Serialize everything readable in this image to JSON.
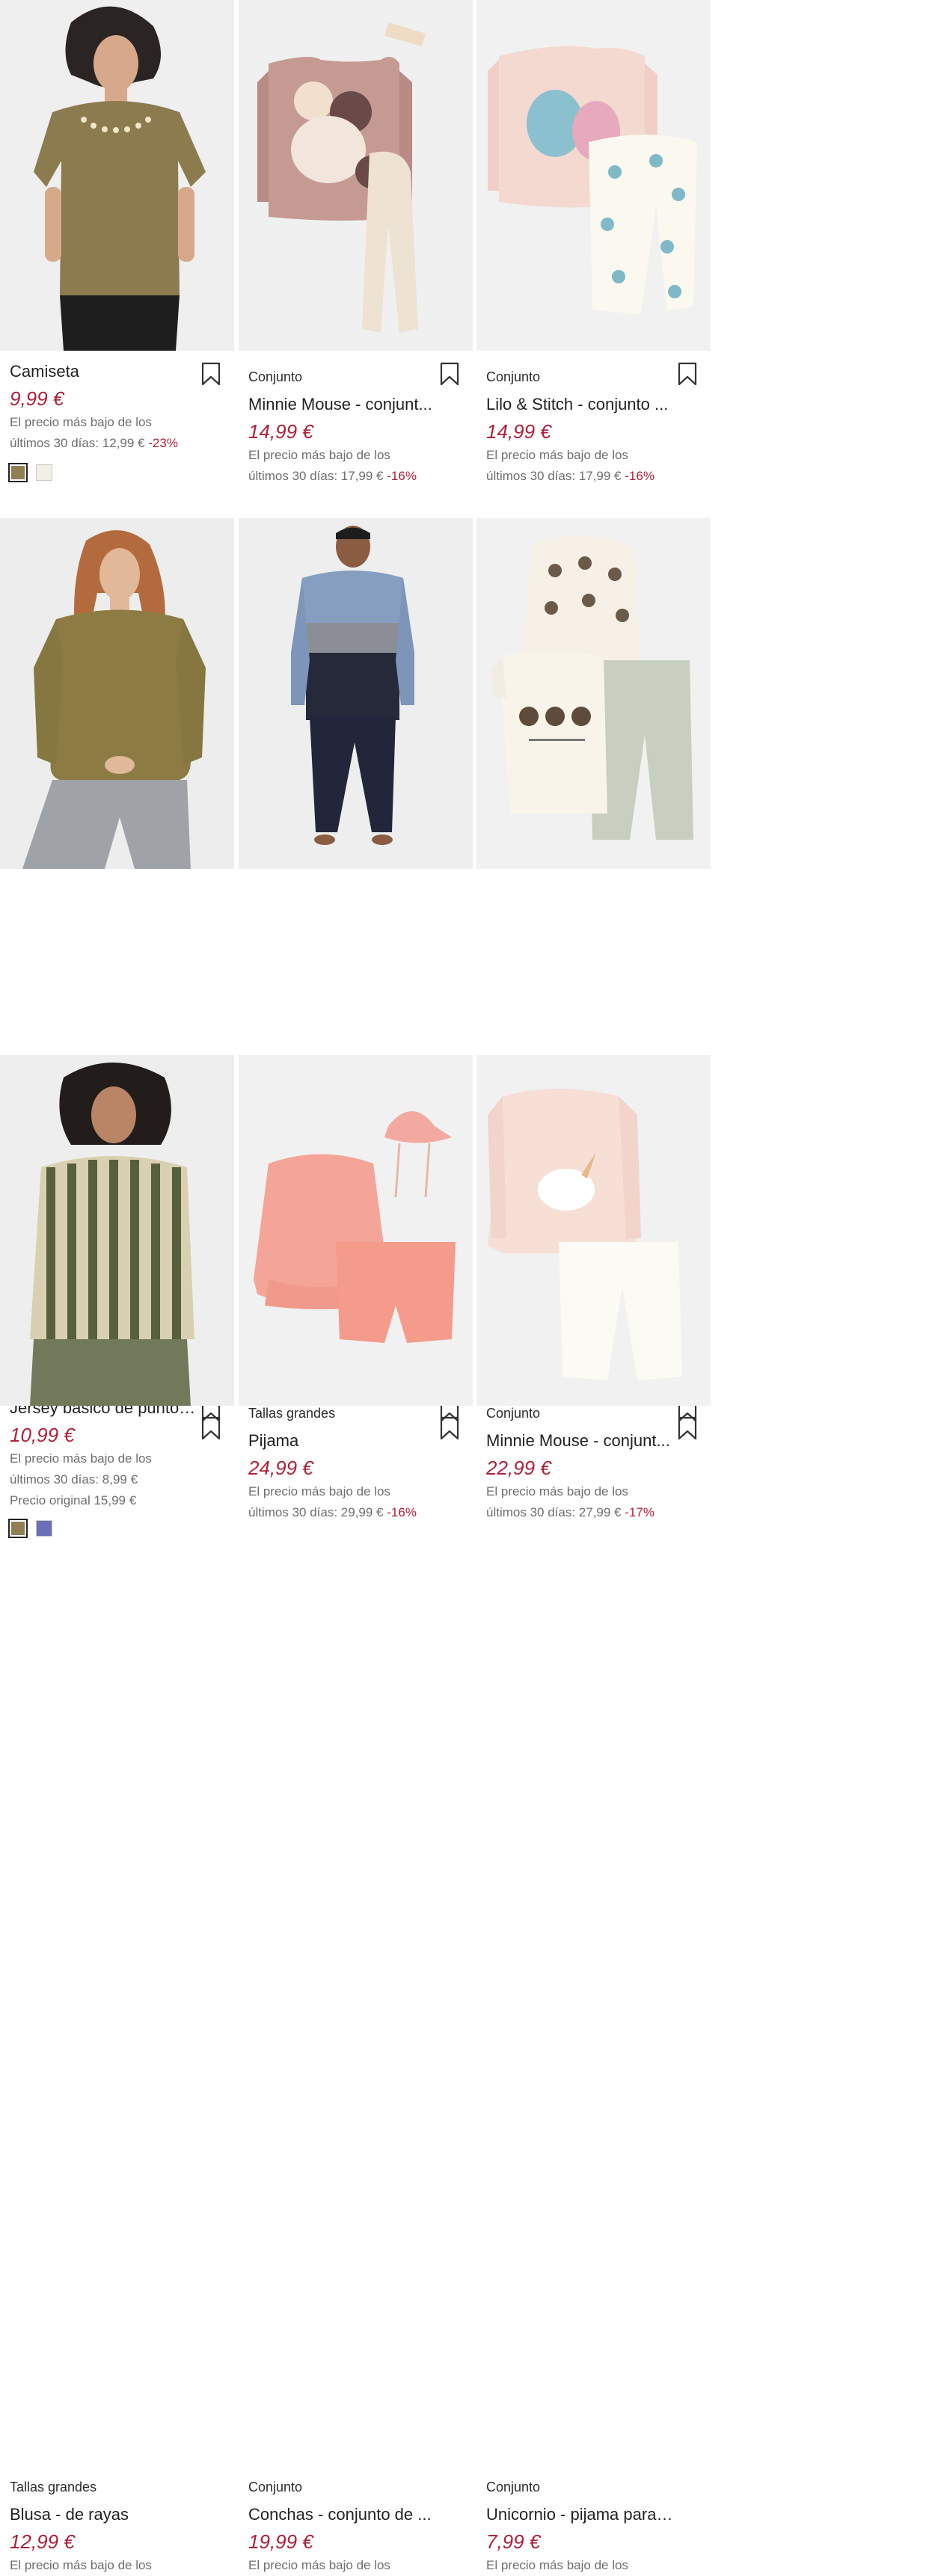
{
  "products": [
    {
      "category": "",
      "title": "Camiseta",
      "price": "9,99 €",
      "ref_line1": "El precio más bajo de los",
      "ref_line2": "últimos 30 días: 12,99 €",
      "discount": "-23%",
      "original": "",
      "swatches": [
        "#8f7f52",
        "#f1efe6"
      ],
      "image": "woman-olive-tshirt"
    },
    {
      "category": "Conjunto",
      "title": "Minnie Mouse - conjunt...",
      "price": "14,99 €",
      "ref_line1": "El precio más bajo de los",
      "ref_line2": "últimos 30 días: 17,99 €",
      "discount": "-16%",
      "original": "",
      "swatches": [],
      "image": "minnie-set-pink"
    },
    {
      "category": "Conjunto",
      "title": "Lilo & Stitch - conjunto ...",
      "price": "14,99 €",
      "ref_line1": "El precio más bajo de los",
      "ref_line2": "últimos 30 días: 17,99 €",
      "discount": "-16%",
      "original": "",
      "swatches": [],
      "image": "stitch-set"
    },
    {
      "category": "",
      "title": "Jersey básico de punto f...",
      "price": "10,99 €",
      "ref_line1": "El precio más bajo de los",
      "ref_line2": "últimos 30 días: 8,99 €",
      "discount": "",
      "original": "Precio original 15,99 €",
      "swatches": [
        "#8f7f52",
        "#6a6fb6"
      ],
      "image": "woman-olive-sweater"
    },
    {
      "category": "Tallas grandes",
      "title": "Pijama",
      "price": "24,99 €",
      "ref_line1": "El precio más bajo de los",
      "ref_line2": "últimos 30 días: 29,99 €",
      "discount": "-16%",
      "original": "",
      "swatches": [],
      "image": "man-pyjama"
    },
    {
      "category": "Conjunto",
      "title": "Minnie Mouse - conjunt...",
      "price": "22,99 €",
      "ref_line1": "El precio más bajo de los",
      "ref_line2": "últimos 30 días: 27,99 €",
      "discount": "-17%",
      "original": "",
      "swatches": [],
      "image": "minnie-set-3piece"
    },
    {
      "category": "Tallas grandes",
      "title": "Blusa - de rayas",
      "price": "12,99 €",
      "ref_line1": "El precio más bajo de los",
      "ref_line2": "",
      "discount": "",
      "original": "",
      "swatches": [],
      "image": "woman-striped-blouse"
    },
    {
      "category": "Conjunto",
      "title": "Conchas - conjunto de ...",
      "price": "19,99 €",
      "ref_line1": "El precio más bajo de los",
      "ref_line2": "",
      "discount": "",
      "original": "",
      "swatches": [],
      "image": "coral-swim-set"
    },
    {
      "category": "Conjunto",
      "title": "Unicornio - pijama para ...",
      "price": "7,99 €",
      "ref_line1": "El precio más bajo de los",
      "ref_line2": "",
      "discount": "",
      "original": "",
      "swatches": [],
      "image": "unicorn-pyjama"
    }
  ]
}
